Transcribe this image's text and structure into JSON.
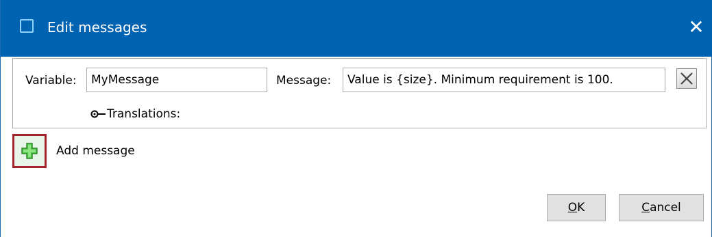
{
  "window": {
    "title": "Edit messages",
    "close_glyph": "✕",
    "title_bar_color": "#0063b1"
  },
  "message_row": {
    "variable_label": "Variable:",
    "variable_value": "MyMessage",
    "message_label": "Message:",
    "message_value": "Value is {size}. Minimum requirement is 100.",
    "delete_icon": "close-x-icon",
    "translations_label": "Translations:",
    "translations_icon": "expand-key-icon"
  },
  "add_message": {
    "label": "Add message",
    "icon": "green-plus-icon",
    "highlight_color": "#a3242b"
  },
  "buttons": {
    "ok_mnemonic": "O",
    "ok_rest": "K",
    "cancel_mnemonic": "C",
    "cancel_rest": "ancel"
  }
}
